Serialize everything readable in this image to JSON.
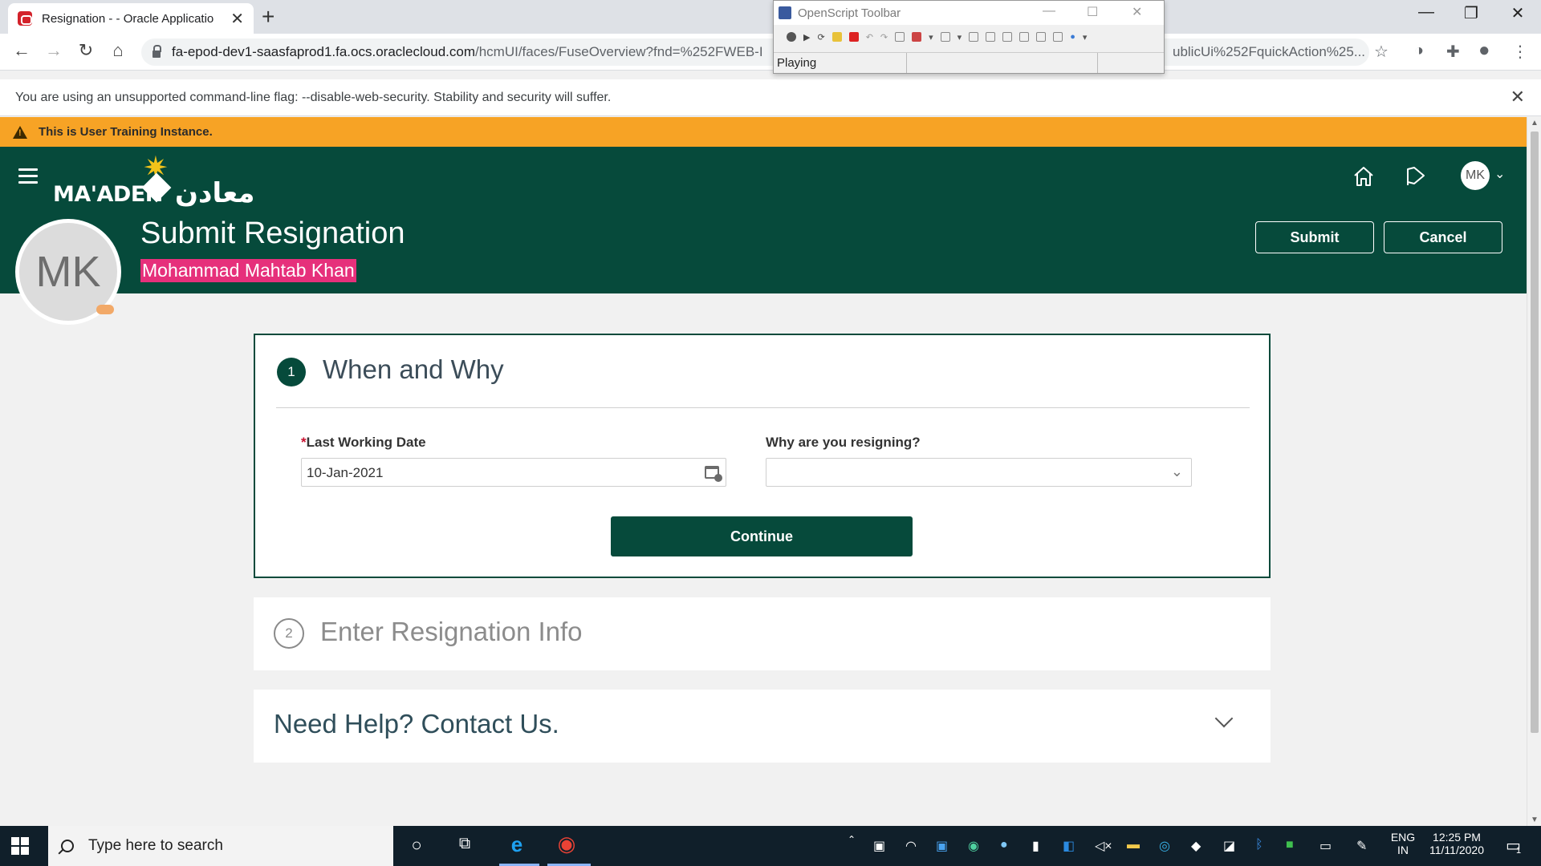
{
  "browser": {
    "tab_title": "Resignation - - Oracle Applicatio",
    "url_host": "fa-epod-dev1-saasfaprod1.fa.ocs.oraclecloud.com",
    "url_path": "/hcmUI/faces/FuseOverview?fnd=%252FWEB-I",
    "url_tail": "ublicUi%252FquickAction%25...",
    "infobar_message": "You are using an unsupported command-line flag: --disable-web-security. Stability and security will suffer."
  },
  "openscript": {
    "title": "OpenScript Toolbar",
    "status": "Playing"
  },
  "banner": {
    "text": "This is User Training Instance."
  },
  "header": {
    "logo_latin": "MA'ADEN",
    "logo_arabic": "معادن",
    "user_initials": "MK",
    "page_title": "Submit Resignation",
    "person_name": "Mohammad Mahtab Khan",
    "submit_label": "Submit",
    "cancel_label": "Cancel"
  },
  "step1": {
    "number": "1",
    "title": "When and Why",
    "last_working_date_label": "Last Working Date",
    "required_marker": "*",
    "last_working_date_value": "10-Jan-2021",
    "reason_label": "Why are you resigning?",
    "reason_value": "",
    "continue_label": "Continue"
  },
  "step2": {
    "number": "2",
    "title": "Enter Resignation Info"
  },
  "help": {
    "title": "Need Help? Contact Us."
  },
  "taskbar": {
    "search_placeholder": "Type here to search",
    "lang_top": "ENG",
    "lang_bottom": "IN",
    "time": "12:25 PM",
    "date": "11/11/2020",
    "notification_count": "1"
  },
  "colors": {
    "brand": "#064a3b",
    "banner": "#f7a325",
    "name_highlight": "#e6307b"
  }
}
